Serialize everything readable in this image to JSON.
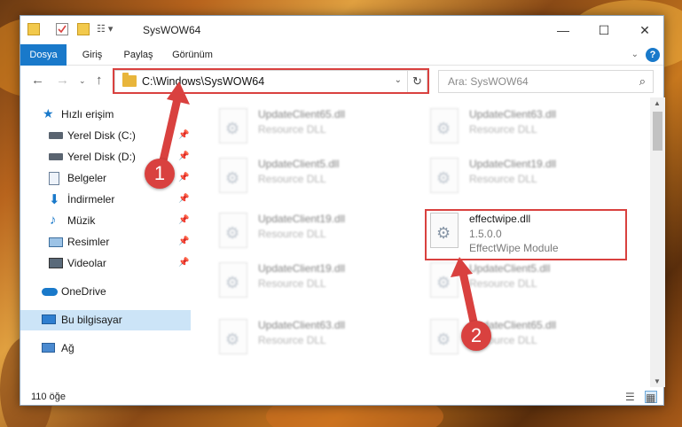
{
  "window": {
    "title": "SysWOW64",
    "controls": {
      "minimize": "—",
      "maximize": "☐",
      "close": "✕"
    }
  },
  "ribbon": {
    "tabs": [
      "Dosya",
      "Giriş",
      "Paylaş",
      "Görünüm"
    ],
    "active_tab": "Dosya",
    "help": "?"
  },
  "address_bar": {
    "path": "C:\\Windows\\SysWOW64",
    "search_placeholder": "Ara: SysWOW64"
  },
  "sidebar": {
    "items": [
      {
        "label": "Hızlı erişim",
        "icon": "star-icon",
        "pinned": false
      },
      {
        "label": "Yerel Disk (C:)",
        "icon": "drive-icon",
        "pinned": true
      },
      {
        "label": "Yerel Disk (D:)",
        "icon": "drive-icon",
        "pinned": true
      },
      {
        "label": "Belgeler",
        "icon": "documents-icon",
        "pinned": true
      },
      {
        "label": "İndirmeler",
        "icon": "download-icon",
        "pinned": true
      },
      {
        "label": "Müzik",
        "icon": "music-icon",
        "pinned": true
      },
      {
        "label": "Resimler",
        "icon": "pictures-icon",
        "pinned": true
      },
      {
        "label": "Videolar",
        "icon": "videos-icon",
        "pinned": true
      },
      {
        "label": "OneDrive",
        "icon": "cloud-icon",
        "pinned": false
      },
      {
        "label": "Bu bilgisayar",
        "icon": "computer-icon",
        "pinned": false,
        "selected": true
      },
      {
        "label": "Ağ",
        "icon": "network-icon",
        "pinned": false
      }
    ]
  },
  "files": [
    {
      "name": "UpdateClient65.dll",
      "desc": "Resource DLL"
    },
    {
      "name": "UpdateClient63.dll",
      "desc": "Resource DLL"
    },
    {
      "name": "UpdateClient5.dll",
      "desc": "Resource DLL"
    },
    {
      "name": "UpdateClient19.dll",
      "desc": "Resource DLL"
    },
    {
      "name": "UpdateClient19.dll",
      "desc": "Resource DLL"
    },
    {
      "name": "effectwipe.dll",
      "desc": "1.5.0.0",
      "desc2": "EffectWipe Module"
    },
    {
      "name": "UpdateClient19.dll",
      "desc": "Resource DLL"
    },
    {
      "name": "UpdateClient5.dll",
      "desc": "Resource DLL"
    },
    {
      "name": "UpdateClient63.dll",
      "desc": "Resource DLL"
    },
    {
      "name": "UpdateClient65.dll",
      "desc": "Resource DLL"
    }
  ],
  "status_bar": {
    "item_count": "110 öğe"
  },
  "callouts": {
    "step1": "1",
    "step2": "2"
  },
  "colors": {
    "accent": "#1979ca",
    "highlight": "#d9413f",
    "selection": "#cce4f7"
  }
}
